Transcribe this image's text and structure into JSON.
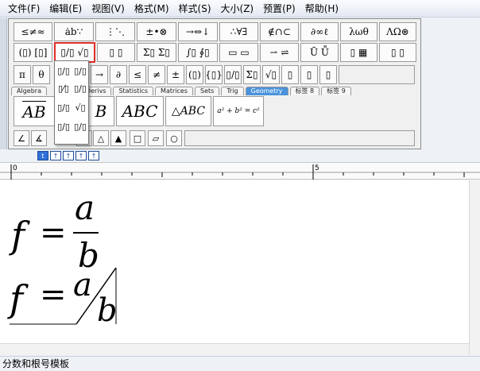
{
  "menubar": {
    "items": [
      "文件(F)",
      "编辑(E)",
      "视图(V)",
      "格式(M)",
      "样式(S)",
      "大小(Z)",
      "预置(P)",
      "帮助(H)"
    ]
  },
  "palette": {
    "row1": [
      "≤≠≈",
      "ȧb∵",
      "⋮⋱",
      "±•⊗",
      "→⇔↓",
      "∴∀∃",
      "∉∩⊂",
      "∂∞ℓ",
      "λωθ",
      "ΛΩ⊛"
    ],
    "row2": [
      "(▯) [▯]",
      "▯/▯ √▯",
      "▯ ▯",
      "Σ▯ Σ▯",
      "∫▯ ∮▯",
      "▭ ▭",
      "⇀ ⇌",
      "Ū Ǚ",
      "▯ ▦",
      "▯ ▯"
    ],
    "row3": [
      "π",
      "θ",
      "→",
      "∂",
      "≤",
      "≠",
      "±",
      "(▯)",
      "{▯}",
      "▯/▯",
      "Σ▯",
      "√▯",
      "▯",
      "▯",
      "▯"
    ],
    "tabs": [
      "Algebra",
      "Derivs",
      "Statistics",
      "Matrices",
      "Sets",
      "Trig",
      "Geometry",
      "标签 8",
      "标签 9"
    ],
    "active_tab": "Geometry",
    "geometry_items": {
      "overline": "AB",
      "arc": "ABC",
      "triangle": "△ABC",
      "pythagoras": "a² + b² = c²"
    },
    "shape_row": [
      "∠",
      "∡",
      "⊿",
      "△",
      "▲",
      "□",
      "▱",
      "○"
    ]
  },
  "dropdown": {
    "items": [
      "▯/▯",
      "▯/▯",
      "▯⁄▯",
      "▯/▯",
      "▯/▯",
      "√▯",
      "▯/▯",
      "▯/▯"
    ]
  },
  "size_buttons": [
    "t",
    "↑",
    "↑",
    "↑",
    "↑"
  ],
  "ruler": {
    "labels": [
      "0",
      "5"
    ]
  },
  "editor": {
    "formula1": {
      "lhs": "f",
      "eq": "=",
      "num": "a",
      "den": "b"
    },
    "formula2": {
      "lhs": "f",
      "eq": "=",
      "num": "a",
      "den": "b"
    }
  },
  "status": {
    "text": "分数和根号模板"
  },
  "colors": {
    "highlight": "#e0302a",
    "active_tab": "#4a93db"
  }
}
